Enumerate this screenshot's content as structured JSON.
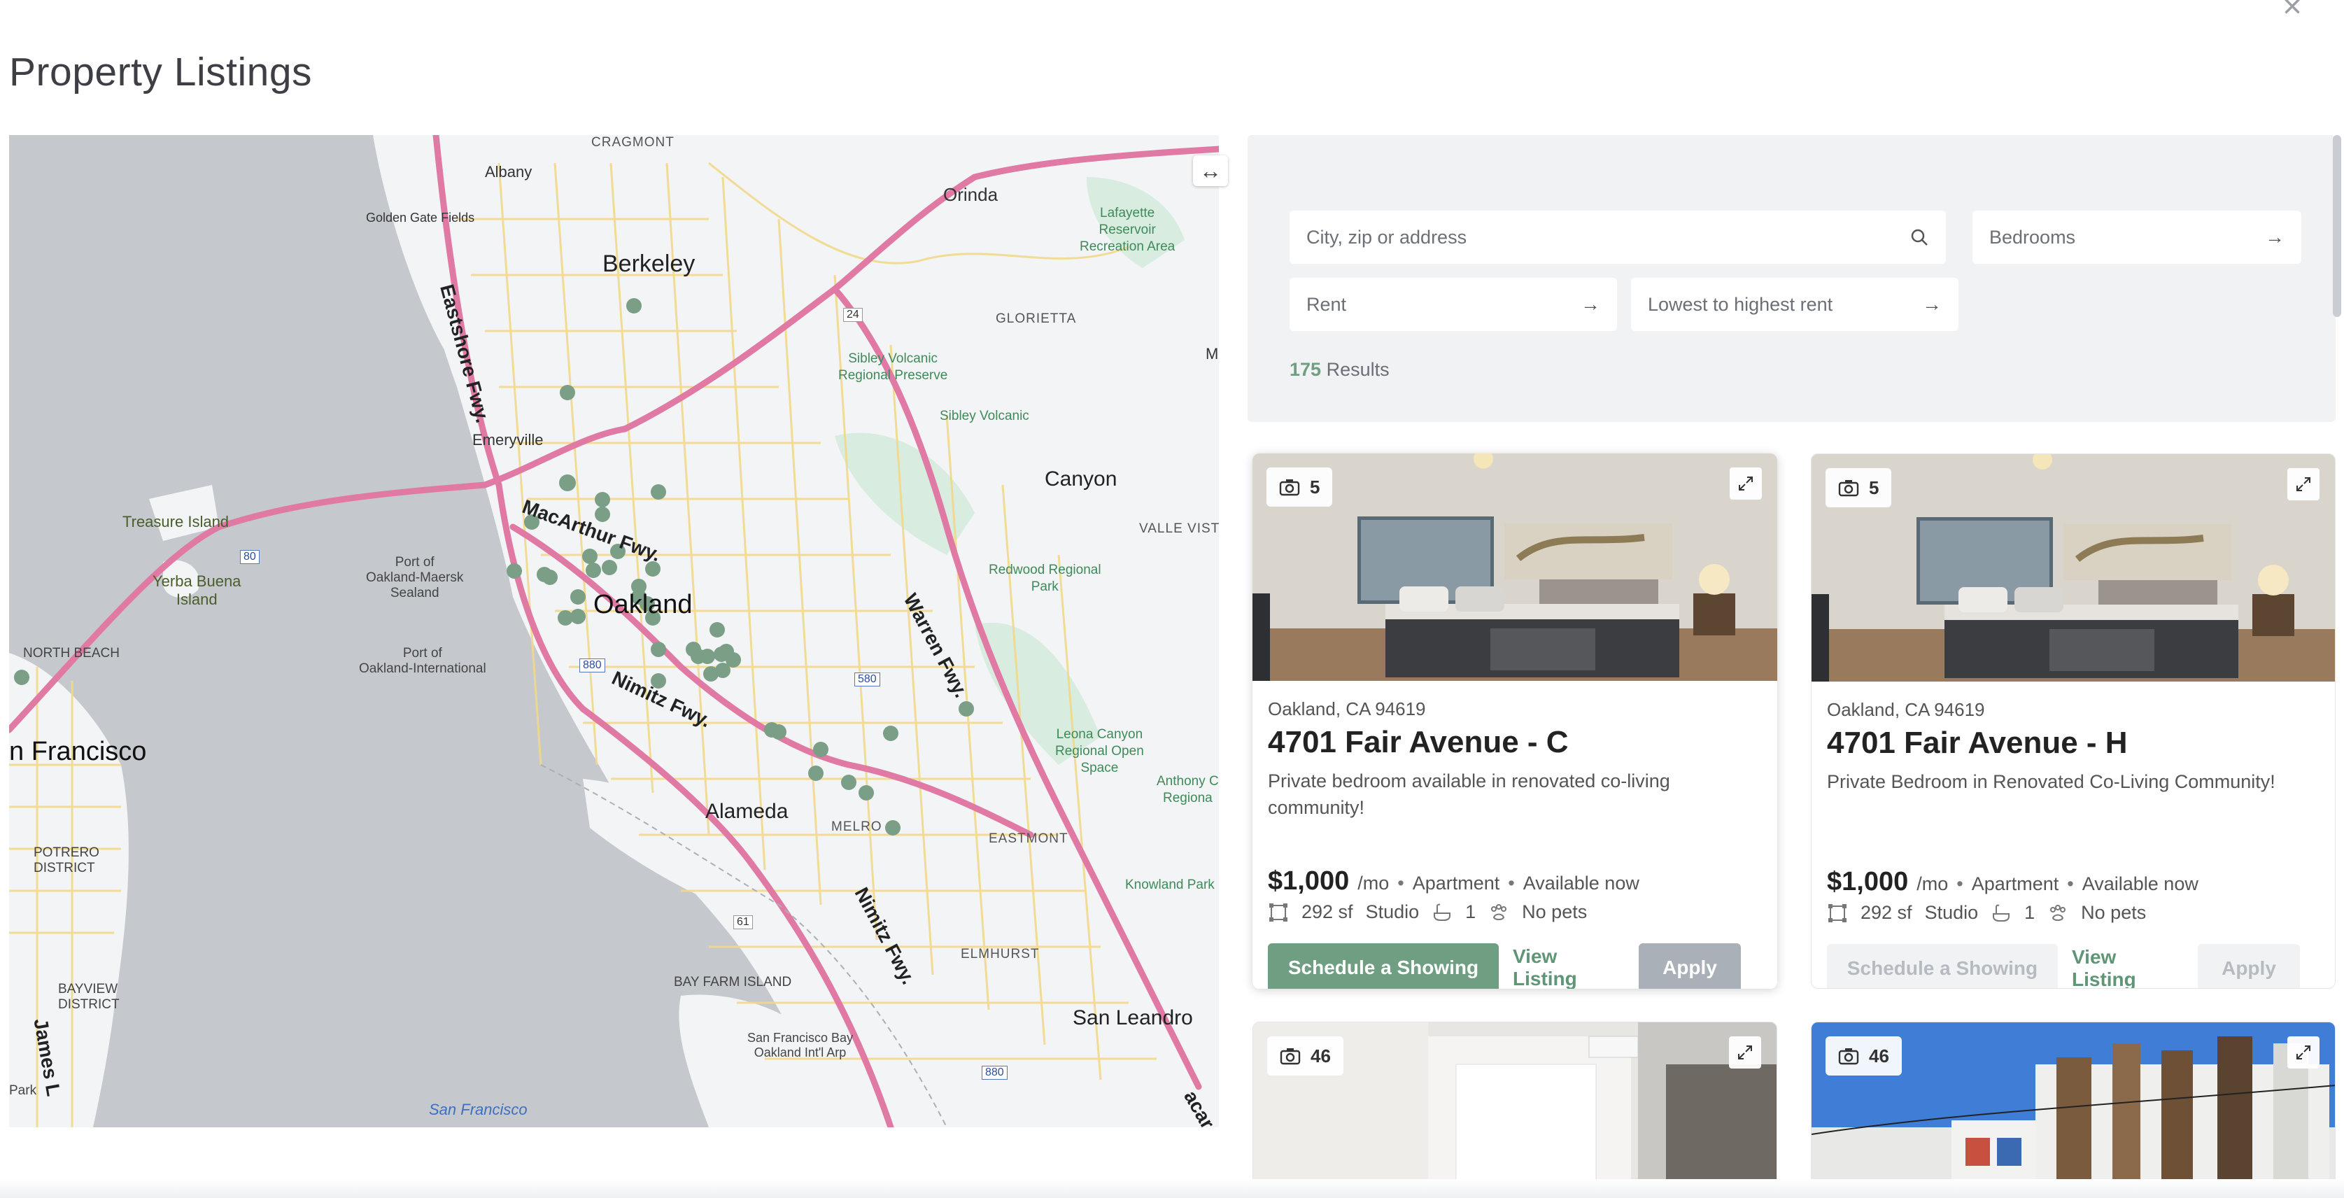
{
  "page": {
    "title": "Property Listings",
    "close_glyph": "×"
  },
  "map": {
    "labels": {
      "cragmont": "CRAGMONT",
      "albany": "Albany",
      "golden_gate_fields": "Golden Gate Fields",
      "orinda": "Orinda",
      "lafayette": "Lafayette\nReservoir\nRecreation Area",
      "berkeley": "Berkeley",
      "eastshore": "Eastshore Fwy.",
      "glorietta": "GLORIETTA",
      "hwy24": "24",
      "sibley": "Sibley Volcanic\nRegional Preserve",
      "sibley2": "Sibley Volcanic",
      "m_edge": "M",
      "emeryville": "Emeryville",
      "canyon": "Canyon",
      "treasure_island": "Treasure Island",
      "macarthur": "MacArthur Fwy.",
      "valle_vista": "VALLE VISTA",
      "hwy80": "80",
      "yerba_buena": "Yerba Buena\nIsland",
      "port_oakland_maersk": "Port of\nOakland-Maersk\nSealand",
      "oakland": "Oakland",
      "redwood": "Redwood Regional\nPark",
      "warren": "Warren Fwy.",
      "north_beach": "NORTH BEACH",
      "port_oakland_intl": "Port of\nOakland-International",
      "hwy880": "880",
      "nimitz": "Nimitz Fwy.",
      "hwy580": "580",
      "san_francisco": "n Francisco",
      "leona": "Leona Canyon\nRegional Open\nSpace",
      "anthony": "Anthony C\nRegiona",
      "alameda": "Alameda",
      "melrose": "MELRO",
      "eastmont": "EASTMONT",
      "potrero": "POTRERO\nDISTRICT",
      "knowland": "Knowland Park",
      "hwy61": "61",
      "nimitz2": "Nimitz Fwy.",
      "elmhurst": "ELMHURST",
      "bayview": "BAYVIEW\nDISTRICT",
      "bay_farm": "BAY FARM ISLAND",
      "sfo_oak": "San Francisco Bay\nOakland Int'l Arp",
      "san_leandro": "San Leandro",
      "hwy880b": "880",
      "james": "James L",
      "park": "Park",
      "sf_bay": "San Francisco",
      "cacar": "acar"
    },
    "zoom_out": "−",
    "zoom_in": "+",
    "expand_glyph": "↔",
    "marker_color": "#7a9e86",
    "colors": {
      "land": "#f2f4f6",
      "water": "#c5c9ce",
      "highway": "#e07aa4",
      "major_road": "#f2d98a",
      "park": "#d8ece0"
    }
  },
  "filters": {
    "search_placeholder": "City, zip or address",
    "bedrooms": "Bedrooms",
    "rent": "Rent",
    "sort": "Lowest to highest rent",
    "results_count": "175",
    "results_label": "Results"
  },
  "listings": [
    {
      "photo_count": "5",
      "location": "Oakland, CA 94619",
      "title": "4701 Fair Avenue - C",
      "description": "Private bedroom available in renovated co-living community!",
      "price": "$1,000",
      "per": "/mo",
      "type": "Apartment",
      "availability": "Available now",
      "sqft": "292 sf",
      "beds": "Studio",
      "baths": "1",
      "pets": "No pets",
      "btn_schedule": "Schedule a Showing",
      "btn_view": "View Listing",
      "btn_apply": "Apply"
    },
    {
      "photo_count": "5",
      "location": "Oakland, CA 94619",
      "title": "4701 Fair Avenue - H",
      "description": "Private Bedroom in Renovated Co-Living Community!",
      "price": "$1,000",
      "per": "/mo",
      "type": "Apartment",
      "availability": "Available now",
      "sqft": "292 sf",
      "beds": "Studio",
      "baths": "1",
      "pets": "No pets",
      "btn_schedule": "Schedule a Showing",
      "btn_view": "View Listing",
      "btn_apply": "Apply"
    },
    {
      "photo_count": "46"
    },
    {
      "photo_count": "46"
    }
  ],
  "icons": {
    "search": "search-icon",
    "camera": "camera-icon",
    "expand": "expand-icon",
    "arrow": "arrow-right-icon"
  },
  "theme": {
    "accent": "#6f9e82",
    "muted": "#aab0b7"
  }
}
